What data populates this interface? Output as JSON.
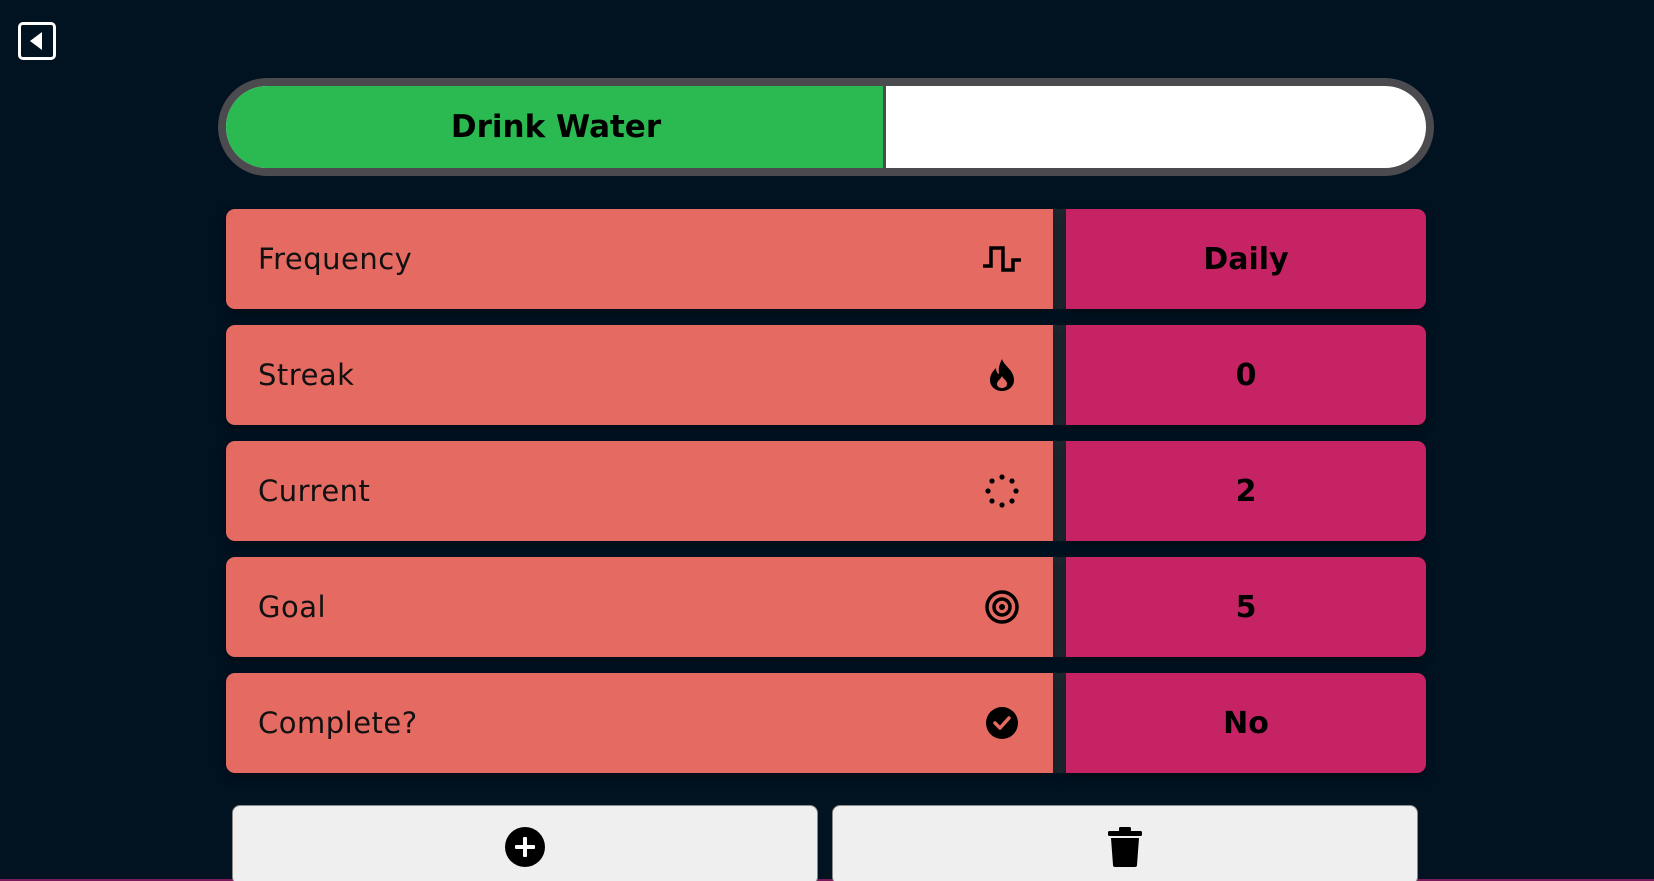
{
  "navigation": {
    "back_icon": "caret-left-square-icon"
  },
  "habit": {
    "title": "Drink Water",
    "progress_fraction": 0.55,
    "colors": {
      "progress_fill": "#2bb952",
      "progress_track": "#ffffff",
      "label_background": "#e56b62",
      "value_background": "#c62365",
      "page_background": "#011221"
    }
  },
  "details": [
    {
      "label": "Frequency",
      "icon": "pulse-wave-icon",
      "value": "Daily"
    },
    {
      "label": "Streak",
      "icon": "fire-icon",
      "value": "0"
    },
    {
      "label": "Current",
      "icon": "loading-dots-icon",
      "value": "2"
    },
    {
      "label": "Goal",
      "icon": "target-icon",
      "value": "5"
    },
    {
      "label": "Complete?",
      "icon": "check-circle-icon",
      "value": "No"
    }
  ],
  "actions": {
    "add_icon": "plus-circle-icon",
    "delete_icon": "trash-icon"
  }
}
